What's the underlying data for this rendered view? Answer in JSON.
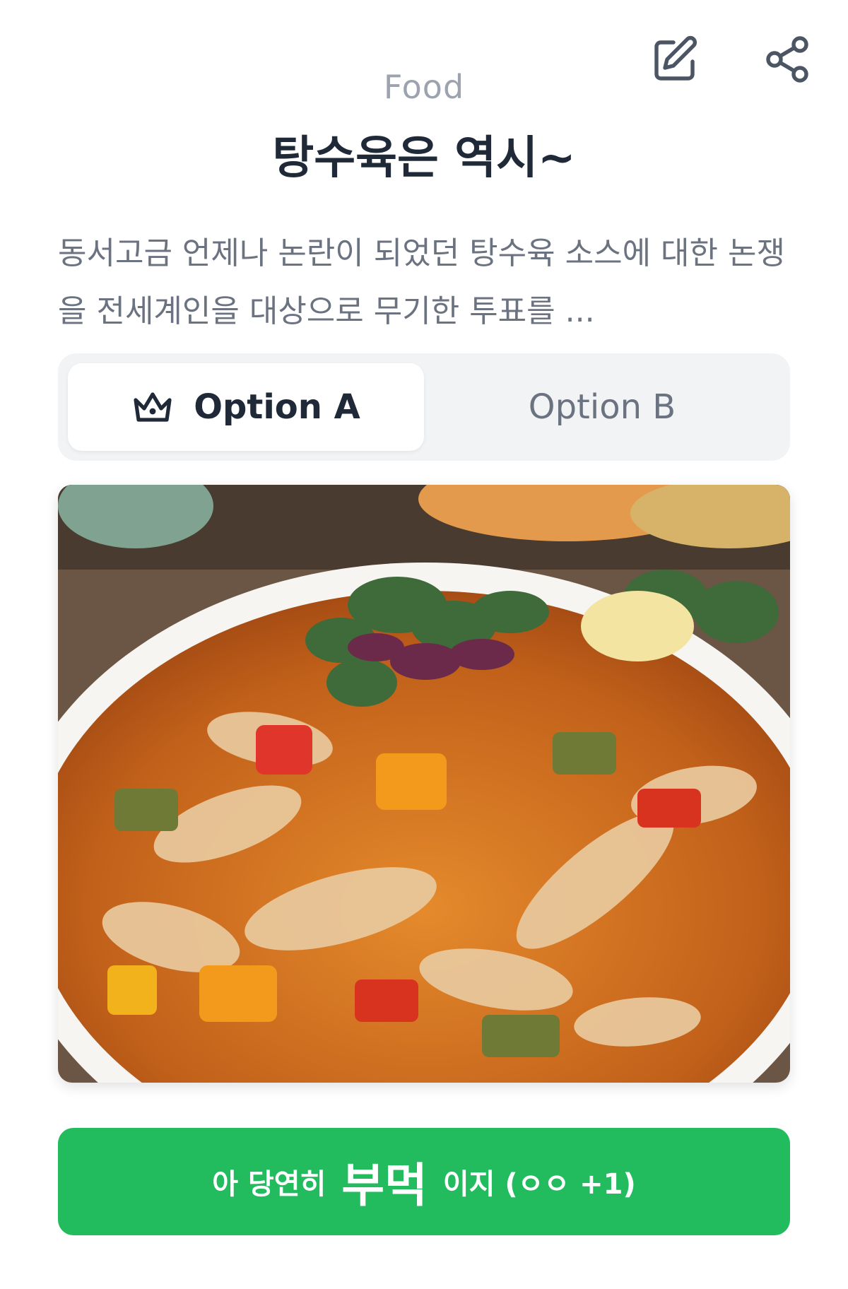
{
  "header": {
    "category": "Food",
    "title": "탕수육은 역시~",
    "icons": {
      "edit": "pencil-edit-icon",
      "share": "share-icon"
    }
  },
  "description": "동서고금 언제나 논란이 되었던 탕수육 소스에 대한 논쟁을 전세계인을 대상으로 무기한 투표를 ...",
  "options": {
    "a_label": "Option A",
    "b_label": "Option B",
    "selected": "A",
    "selected_icon": "crown-icon"
  },
  "image": {
    "subject": "food-photo"
  },
  "vote": {
    "prefix": "아 당연히",
    "emphasis": "부먹",
    "suffix": "이지 (ㅇㅇ +1)"
  },
  "colors": {
    "accent": "#22bb5e",
    "title": "#1f2937",
    "muted": "#9ca3af",
    "segment_bg": "#f1f3f5"
  }
}
